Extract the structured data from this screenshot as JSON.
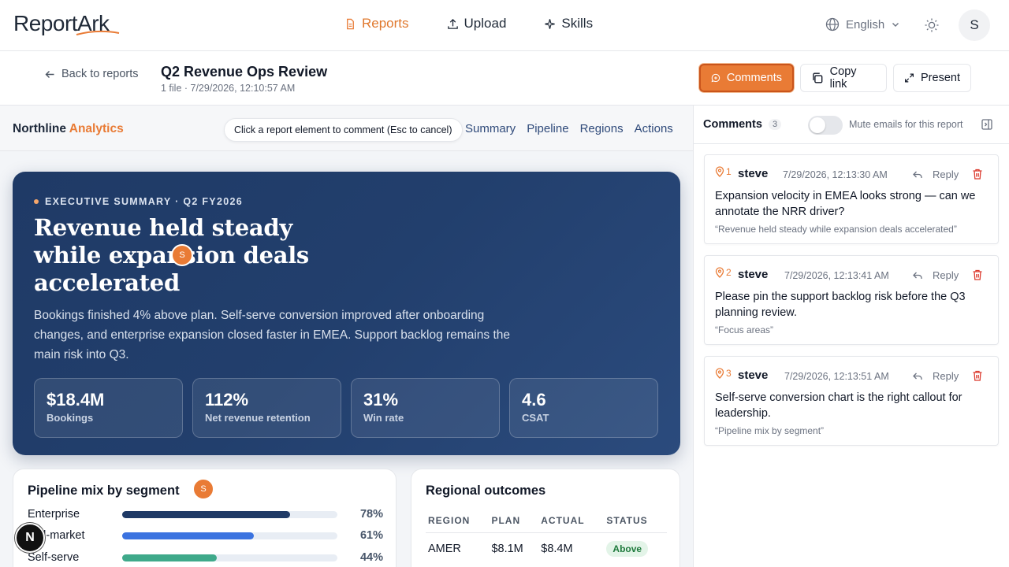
{
  "app": {
    "logo": "ReportArk",
    "nav": [
      {
        "label": "Reports",
        "icon": "document-icon",
        "active": true
      },
      {
        "label": "Upload",
        "icon": "upload-icon",
        "active": false
      },
      {
        "label": "Skills",
        "icon": "sparkle-icon",
        "active": false
      }
    ],
    "language": "English",
    "user_initial": "S"
  },
  "subheader": {
    "back_label": "Back to reports",
    "title": "Q2 Revenue Ops Review",
    "meta": "1 file · 7/29/2026, 12:10:57 AM",
    "comments_label": "Comments",
    "copy_label": "Copy link",
    "present_label": "Present"
  },
  "report": {
    "brand_main": "Northline",
    "brand_accent": "Analytics",
    "hint": "Click a report element to comment (Esc to cancel)",
    "nav": [
      "Summary",
      "Pipeline",
      "Regions",
      "Actions"
    ],
    "hero": {
      "eyebrow": "EXECUTIVE SUMMARY · Q2 FY2026",
      "headline": "Revenue held steady while expansion deals accelerated",
      "lede": "Bookings finished 4% above plan. Self-serve conversion improved after onboarding changes, and enterprise expansion closed faster in EMEA. Support backlog remains the main risk into Q3.",
      "kpis": [
        {
          "value": "$18.4M",
          "label": "Bookings"
        },
        {
          "value": "112%",
          "label": "Net revenue retention"
        },
        {
          "value": "31%",
          "label": "Win rate"
        },
        {
          "value": "4.6",
          "label": "CSAT"
        }
      ]
    },
    "pin_initial": "S",
    "pipeline": {
      "title": "Pipeline mix by segment",
      "rows": [
        {
          "name": "Enterprise",
          "value": 78,
          "label": "78%",
          "color": "#1f3a66"
        },
        {
          "name": "Mid-market",
          "value": 61,
          "label": "61%",
          "color": "#3b73e0"
        },
        {
          "name": "Self-serve",
          "value": 44,
          "label": "44%",
          "color": "#3fa98a"
        }
      ]
    },
    "regions": {
      "title": "Regional outcomes",
      "headers": [
        "REGION",
        "PLAN",
        "ACTUAL",
        "STATUS"
      ],
      "rows": [
        {
          "region": "AMER",
          "plan": "$8.1M",
          "actual": "$8.4M",
          "status": "Above"
        }
      ]
    },
    "floating_badge": "N"
  },
  "comments_panel": {
    "title": "Comments",
    "count": "3",
    "mute_label": "Mute emails for this report",
    "reply_label": "Reply",
    "items": [
      {
        "num": "1",
        "author": "steve",
        "time": "7/29/2026, 12:13:30 AM",
        "body": "Expansion velocity in EMEA looks strong — can we annotate the NRR driver?",
        "quote": "“Revenue held steady while expansion deals accelerated”"
      },
      {
        "num": "2",
        "author": "steve",
        "time": "7/29/2026, 12:13:41 AM",
        "body": "Please pin the support backlog risk before the Q3 planning review.",
        "quote": "“Focus areas”"
      },
      {
        "num": "3",
        "author": "steve",
        "time": "7/29/2026, 12:13:51 AM",
        "body": "Self-serve conversion chart is the right callout for leadership.",
        "quote": "“Pipeline mix by segment”"
      }
    ]
  }
}
